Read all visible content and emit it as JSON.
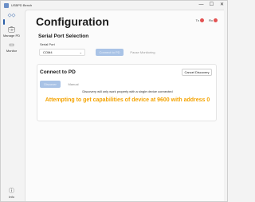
{
  "window": {
    "title": "USBPD Bench",
    "controls": {
      "minimize": "—",
      "maximize": "☐",
      "close": "✕"
    }
  },
  "sidebar": {
    "items": [
      {
        "label": "",
        "icon": "mode-icon"
      },
      {
        "label": "Manage PD",
        "icon": "briefcase-icon"
      },
      {
        "label": "Monitor",
        "icon": "monitor-icon"
      }
    ],
    "footer": {
      "label": "Info",
      "icon": "info-icon"
    }
  },
  "header": {
    "title": "Configuration",
    "chips": [
      {
        "label": "Tx",
        "color": "#e35252"
      },
      {
        "label": "Rx",
        "color": "#e35252"
      }
    ]
  },
  "serial_port": {
    "section_title": "Serial Port Selection",
    "field_label": "Serial Port",
    "selected_port": "COM4",
    "connect_label": "Connect to PD",
    "pause_label": "Pause Monitoring"
  },
  "connect_pd": {
    "section_title": "Connect to PD",
    "cancel_label": "Cancel Discovery",
    "tabs": [
      "Discover",
      "Manual"
    ],
    "note": "Discovery will only work properly with a single device connected",
    "status_message": "Attempting to get capabilities of device at 9600 with address 0",
    "status_color": "#f4a300"
  }
}
